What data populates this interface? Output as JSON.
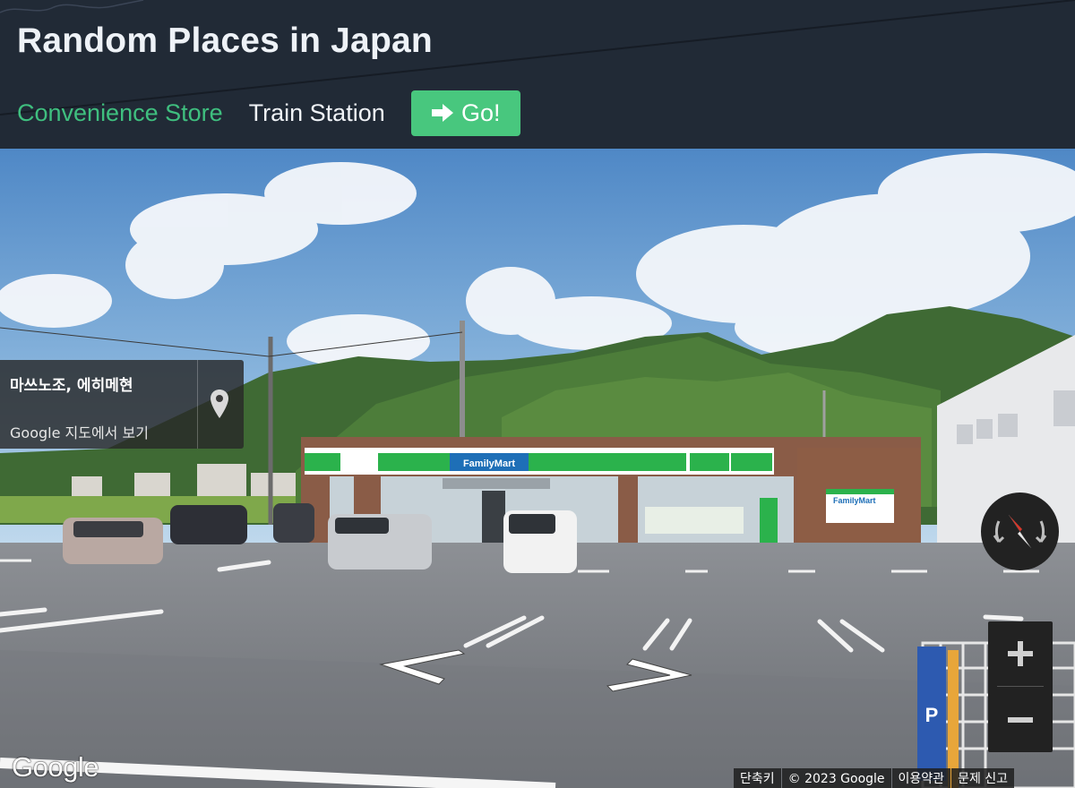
{
  "app": {
    "title": "Random Places in Japan"
  },
  "nav": {
    "items": [
      {
        "label": "Convenience Store",
        "active": true
      },
      {
        "label": "Train Station",
        "active": false
      }
    ],
    "go_label": "Go!",
    "go_icon": "right-arrow-icon"
  },
  "colors": {
    "header_bg": "#212a36",
    "active_link": "#3fbf7f",
    "go_button": "#48c77e"
  },
  "street_view": {
    "place_name": "마쓰노조, 에히메현",
    "maps_link": "Google 지도에서 보기",
    "pin_icon": "map-pin-icon",
    "compass_icon": "compass-icon",
    "zoom_in_icon": "plus-icon",
    "zoom_out_icon": "minus-icon",
    "logo": "Google",
    "attribution": {
      "shortcuts": "단축키",
      "copyright": "© 2023 Google",
      "terms": "이용약관",
      "report": "문제 신고"
    },
    "scene": {
      "store_sign": "FamilyMart",
      "wall_sign": "FamilyMart",
      "parking_sign": "P"
    }
  }
}
